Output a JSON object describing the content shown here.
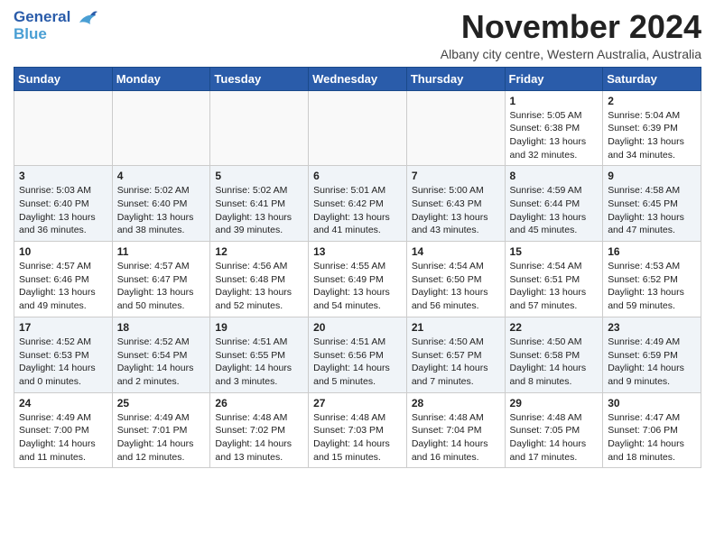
{
  "header": {
    "logo_line1": "General",
    "logo_line2": "Blue",
    "title": "November 2024",
    "subtitle": "Albany city centre, Western Australia, Australia"
  },
  "weekdays": [
    "Sunday",
    "Monday",
    "Tuesday",
    "Wednesday",
    "Thursday",
    "Friday",
    "Saturday"
  ],
  "weeks": [
    [
      {
        "day": "",
        "info": ""
      },
      {
        "day": "",
        "info": ""
      },
      {
        "day": "",
        "info": ""
      },
      {
        "day": "",
        "info": ""
      },
      {
        "day": "",
        "info": ""
      },
      {
        "day": "1",
        "info": "Sunrise: 5:05 AM\nSunset: 6:38 PM\nDaylight: 13 hours\nand 32 minutes."
      },
      {
        "day": "2",
        "info": "Sunrise: 5:04 AM\nSunset: 6:39 PM\nDaylight: 13 hours\nand 34 minutes."
      }
    ],
    [
      {
        "day": "3",
        "info": "Sunrise: 5:03 AM\nSunset: 6:40 PM\nDaylight: 13 hours\nand 36 minutes."
      },
      {
        "day": "4",
        "info": "Sunrise: 5:02 AM\nSunset: 6:40 PM\nDaylight: 13 hours\nand 38 minutes."
      },
      {
        "day": "5",
        "info": "Sunrise: 5:02 AM\nSunset: 6:41 PM\nDaylight: 13 hours\nand 39 minutes."
      },
      {
        "day": "6",
        "info": "Sunrise: 5:01 AM\nSunset: 6:42 PM\nDaylight: 13 hours\nand 41 minutes."
      },
      {
        "day": "7",
        "info": "Sunrise: 5:00 AM\nSunset: 6:43 PM\nDaylight: 13 hours\nand 43 minutes."
      },
      {
        "day": "8",
        "info": "Sunrise: 4:59 AM\nSunset: 6:44 PM\nDaylight: 13 hours\nand 45 minutes."
      },
      {
        "day": "9",
        "info": "Sunrise: 4:58 AM\nSunset: 6:45 PM\nDaylight: 13 hours\nand 47 minutes."
      }
    ],
    [
      {
        "day": "10",
        "info": "Sunrise: 4:57 AM\nSunset: 6:46 PM\nDaylight: 13 hours\nand 49 minutes."
      },
      {
        "day": "11",
        "info": "Sunrise: 4:57 AM\nSunset: 6:47 PM\nDaylight: 13 hours\nand 50 minutes."
      },
      {
        "day": "12",
        "info": "Sunrise: 4:56 AM\nSunset: 6:48 PM\nDaylight: 13 hours\nand 52 minutes."
      },
      {
        "day": "13",
        "info": "Sunrise: 4:55 AM\nSunset: 6:49 PM\nDaylight: 13 hours\nand 54 minutes."
      },
      {
        "day": "14",
        "info": "Sunrise: 4:54 AM\nSunset: 6:50 PM\nDaylight: 13 hours\nand 56 minutes."
      },
      {
        "day": "15",
        "info": "Sunrise: 4:54 AM\nSunset: 6:51 PM\nDaylight: 13 hours\nand 57 minutes."
      },
      {
        "day": "16",
        "info": "Sunrise: 4:53 AM\nSunset: 6:52 PM\nDaylight: 13 hours\nand 59 minutes."
      }
    ],
    [
      {
        "day": "17",
        "info": "Sunrise: 4:52 AM\nSunset: 6:53 PM\nDaylight: 14 hours\nand 0 minutes."
      },
      {
        "day": "18",
        "info": "Sunrise: 4:52 AM\nSunset: 6:54 PM\nDaylight: 14 hours\nand 2 minutes."
      },
      {
        "day": "19",
        "info": "Sunrise: 4:51 AM\nSunset: 6:55 PM\nDaylight: 14 hours\nand 3 minutes."
      },
      {
        "day": "20",
        "info": "Sunrise: 4:51 AM\nSunset: 6:56 PM\nDaylight: 14 hours\nand 5 minutes."
      },
      {
        "day": "21",
        "info": "Sunrise: 4:50 AM\nSunset: 6:57 PM\nDaylight: 14 hours\nand 7 minutes."
      },
      {
        "day": "22",
        "info": "Sunrise: 4:50 AM\nSunset: 6:58 PM\nDaylight: 14 hours\nand 8 minutes."
      },
      {
        "day": "23",
        "info": "Sunrise: 4:49 AM\nSunset: 6:59 PM\nDaylight: 14 hours\nand 9 minutes."
      }
    ],
    [
      {
        "day": "24",
        "info": "Sunrise: 4:49 AM\nSunset: 7:00 PM\nDaylight: 14 hours\nand 11 minutes."
      },
      {
        "day": "25",
        "info": "Sunrise: 4:49 AM\nSunset: 7:01 PM\nDaylight: 14 hours\nand 12 minutes."
      },
      {
        "day": "26",
        "info": "Sunrise: 4:48 AM\nSunset: 7:02 PM\nDaylight: 14 hours\nand 13 minutes."
      },
      {
        "day": "27",
        "info": "Sunrise: 4:48 AM\nSunset: 7:03 PM\nDaylight: 14 hours\nand 15 minutes."
      },
      {
        "day": "28",
        "info": "Sunrise: 4:48 AM\nSunset: 7:04 PM\nDaylight: 14 hours\nand 16 minutes."
      },
      {
        "day": "29",
        "info": "Sunrise: 4:48 AM\nSunset: 7:05 PM\nDaylight: 14 hours\nand 17 minutes."
      },
      {
        "day": "30",
        "info": "Sunrise: 4:47 AM\nSunset: 7:06 PM\nDaylight: 14 hours\nand 18 minutes."
      }
    ]
  ]
}
